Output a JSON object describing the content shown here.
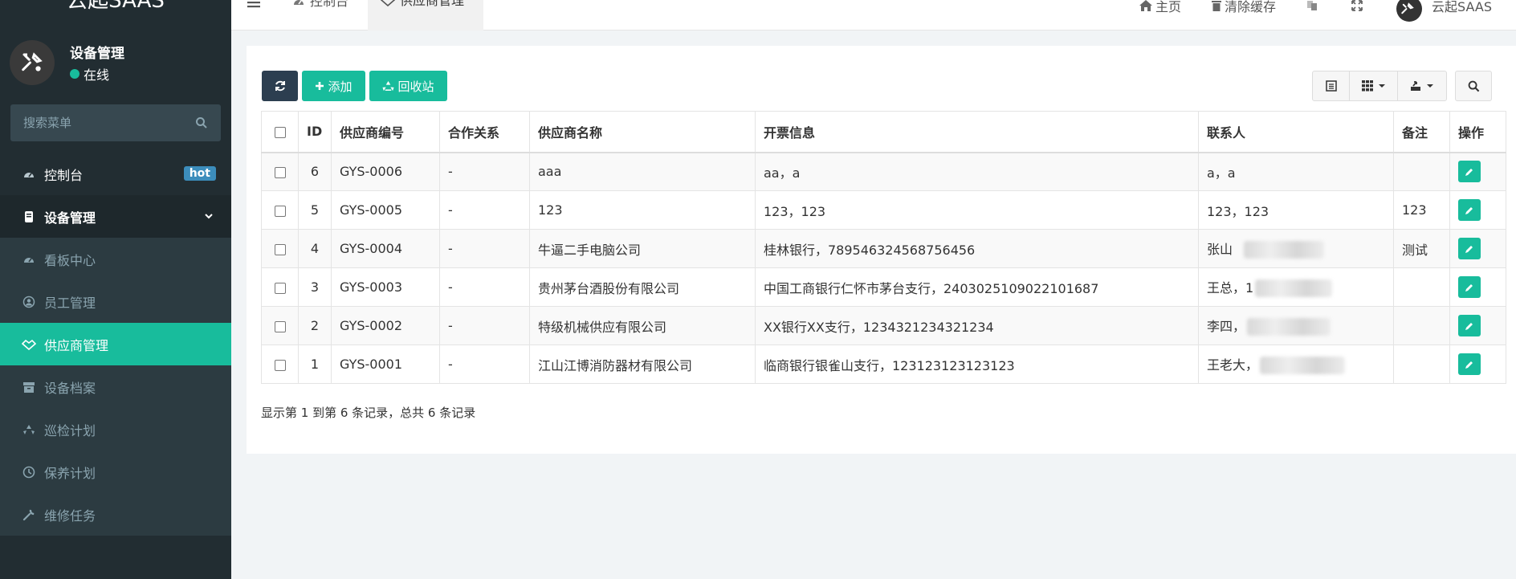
{
  "brand": {
    "title": "云起SAAS"
  },
  "user": {
    "name": "设备管理",
    "status": "在线"
  },
  "sidebar": {
    "search_placeholder": "搜索菜单",
    "items": [
      {
        "label": "控制台",
        "icon": "dashboard-icon",
        "badge": "hot"
      },
      {
        "label": "设备管理",
        "icon": "device-icon"
      },
      {
        "label": "看板中心",
        "icon": "dashboard-icon"
      },
      {
        "label": "员工管理",
        "icon": "user-icon"
      },
      {
        "label": "供应商管理",
        "icon": "handshake-icon"
      },
      {
        "label": "设备档案",
        "icon": "archive-icon"
      },
      {
        "label": "巡检计划",
        "icon": "recycle-icon"
      },
      {
        "label": "保养计划",
        "icon": "clock-icon"
      },
      {
        "label": "维修任务",
        "icon": "wrench-icon"
      }
    ]
  },
  "topbar": {
    "tabs": [
      {
        "label": "控制台"
      },
      {
        "label": "供应商管理"
      }
    ],
    "home": "主页",
    "clear_cache": "清除缓存",
    "account": "云起SAAS"
  },
  "toolbar": {
    "add": "添加",
    "recycle": "回收站"
  },
  "table": {
    "headers": [
      "ID",
      "供应商编号",
      "合作关系",
      "供应商名称",
      "开票信息",
      "联系人",
      "备注",
      "操作"
    ],
    "rows": [
      {
        "id": "6",
        "code": "GYS-0006",
        "relation": "-",
        "name": "aaa",
        "invoice": "aa，a",
        "contact": "a，a",
        "remark": ""
      },
      {
        "id": "5",
        "code": "GYS-0005",
        "relation": "-",
        "name": "123",
        "invoice": "123，123",
        "contact": "123，123",
        "remark": "123"
      },
      {
        "id": "4",
        "code": "GYS-0004",
        "relation": "-",
        "name": "牛逼二手电脑公司",
        "invoice": "桂林银行，789546324568756456",
        "contact": "张山",
        "remark": "测试"
      },
      {
        "id": "3",
        "code": "GYS-0003",
        "relation": "-",
        "name": "贵州茅台酒股份有限公司",
        "invoice": "中国工商银行仁怀市茅台支行，2403025109022101687",
        "contact": "王总，1",
        "remark": ""
      },
      {
        "id": "2",
        "code": "GYS-0002",
        "relation": "-",
        "name": "特级机械供应有限公司",
        "invoice": "XX银行XX支行，1234321234321234",
        "contact": "李四，",
        "remark": ""
      },
      {
        "id": "1",
        "code": "GYS-0001",
        "relation": "-",
        "name": "江山江博消防器材有限公司",
        "invoice": "临商银行银雀山支行，123123123123123",
        "contact": "王老大，",
        "remark": ""
      }
    ]
  },
  "pagination": {
    "info": "显示第 1 到第 6 条记录，总共 6 条记录"
  },
  "colors": {
    "sidebar_bg": "#222d32",
    "accent": "#18bc9c",
    "dark_button": "#2c3e50",
    "hot_badge": "#3c8dbc"
  }
}
